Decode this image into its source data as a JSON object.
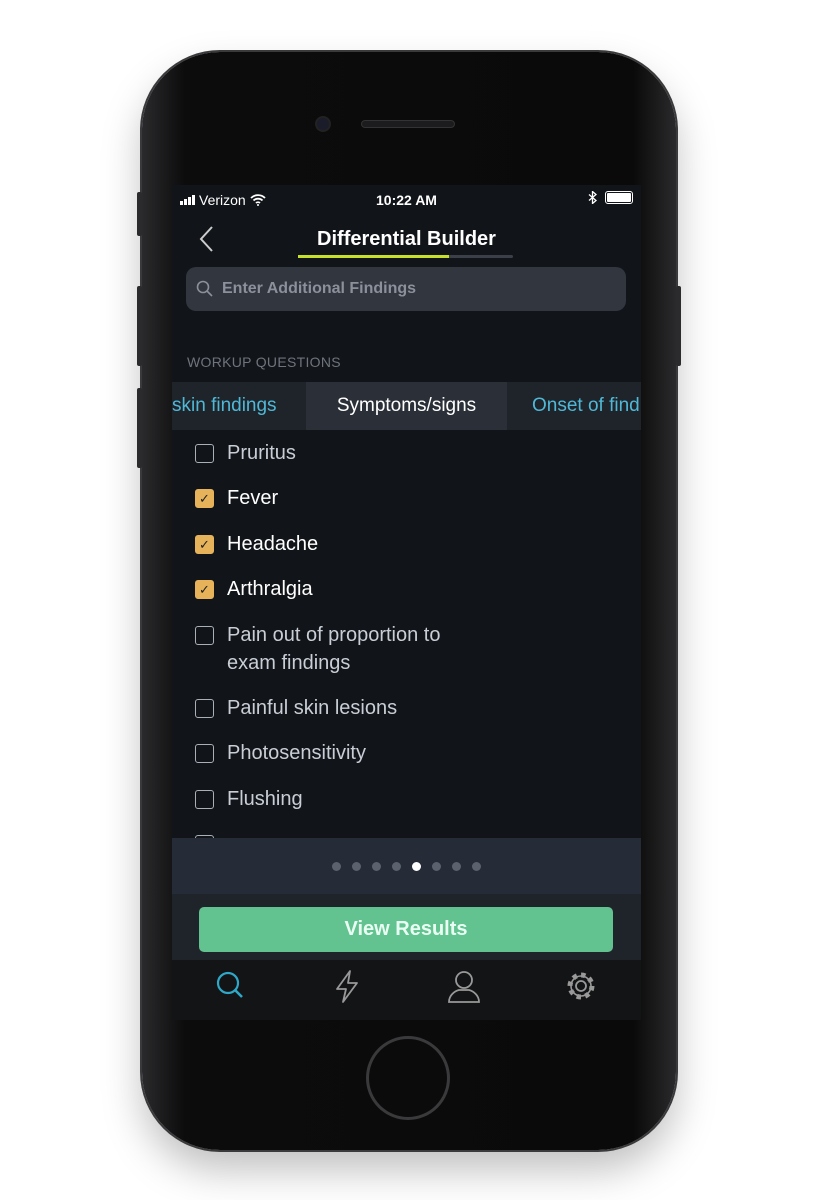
{
  "status": {
    "carrier": "Verizon",
    "time": "10:22 AM"
  },
  "nav": {
    "title": "Differential Builder",
    "progress_percent": 70
  },
  "search": {
    "placeholder": "Enter Additional Findings",
    "value": ""
  },
  "section_label": "WORKUP QUESTIONS",
  "tabs": [
    {
      "label": "skin findings"
    },
    {
      "label": "Symptoms/signs",
      "active": true
    },
    {
      "label": "Onset of findings"
    }
  ],
  "items": [
    {
      "label": "Pruritus",
      "checked": false
    },
    {
      "label": "Fever",
      "checked": true
    },
    {
      "label": "Headache",
      "checked": true
    },
    {
      "label": "Arthralgia",
      "checked": true
    },
    {
      "label": "Pain out of proportion to exam findings",
      "checked": false
    },
    {
      "label": "Painful skin lesions",
      "checked": false
    },
    {
      "label": "Photosensitivity",
      "checked": false
    },
    {
      "label": "Flushing",
      "checked": false
    }
  ],
  "pager": {
    "count": 8,
    "current": 5
  },
  "view_results": "View Results",
  "tabbar": [
    "search-icon",
    "lightning-icon",
    "user-icon",
    "gear-icon"
  ],
  "colors": {
    "accent": "#4fb8d6",
    "check": "#e6b35a",
    "button": "#62c290",
    "progress": "#c7e02a"
  }
}
